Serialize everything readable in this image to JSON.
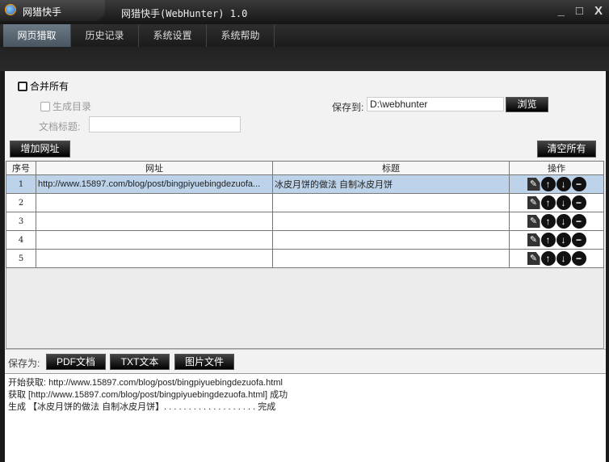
{
  "window": {
    "app_name": "网猎快手",
    "title": "网猎快手(WebHunter) 1.0",
    "min": "_",
    "max": "□",
    "close": "X"
  },
  "tabs": [
    "网页猎取",
    "历史记录",
    "系统设置",
    "系统帮助"
  ],
  "options": {
    "merge_all": "合并所有",
    "gen_toc": "生成目录",
    "doc_title_label": "文档标题:",
    "doc_title_value": "",
    "save_to_label": "保存到:",
    "save_to_value": "D:\\webhunter",
    "browse": "浏览"
  },
  "buttons": {
    "add_url": "增加网址",
    "clear_all": "清空所有"
  },
  "table": {
    "headers": [
      "序号",
      "网址",
      "标题",
      "操作"
    ],
    "rows": [
      {
        "n": "1",
        "url": "http://www.15897.com/blog/post/bingpiyuebingdezuofa...",
        "title": "冰皮月饼的做法 自制冰皮月饼"
      },
      {
        "n": "2",
        "url": "",
        "title": ""
      },
      {
        "n": "3",
        "url": "",
        "title": ""
      },
      {
        "n": "4",
        "url": "",
        "title": ""
      },
      {
        "n": "5",
        "url": "",
        "title": ""
      }
    ]
  },
  "save_as": {
    "label": "保存为:",
    "pdf": "PDF文档",
    "txt": "TXT文本",
    "img": "图片文件"
  },
  "log": [
    "开始获取: http://www.15897.com/blog/post/bingpiyuebingdezuofa.html",
    "获取 [http://www.15897.com/blog/post/bingpiyuebingdezuofa.html] 成功",
    "生成 【冰皮月饼的做法 自制冰皮月饼】. . . . . . . . . . . . . . . . . . . 完成"
  ]
}
